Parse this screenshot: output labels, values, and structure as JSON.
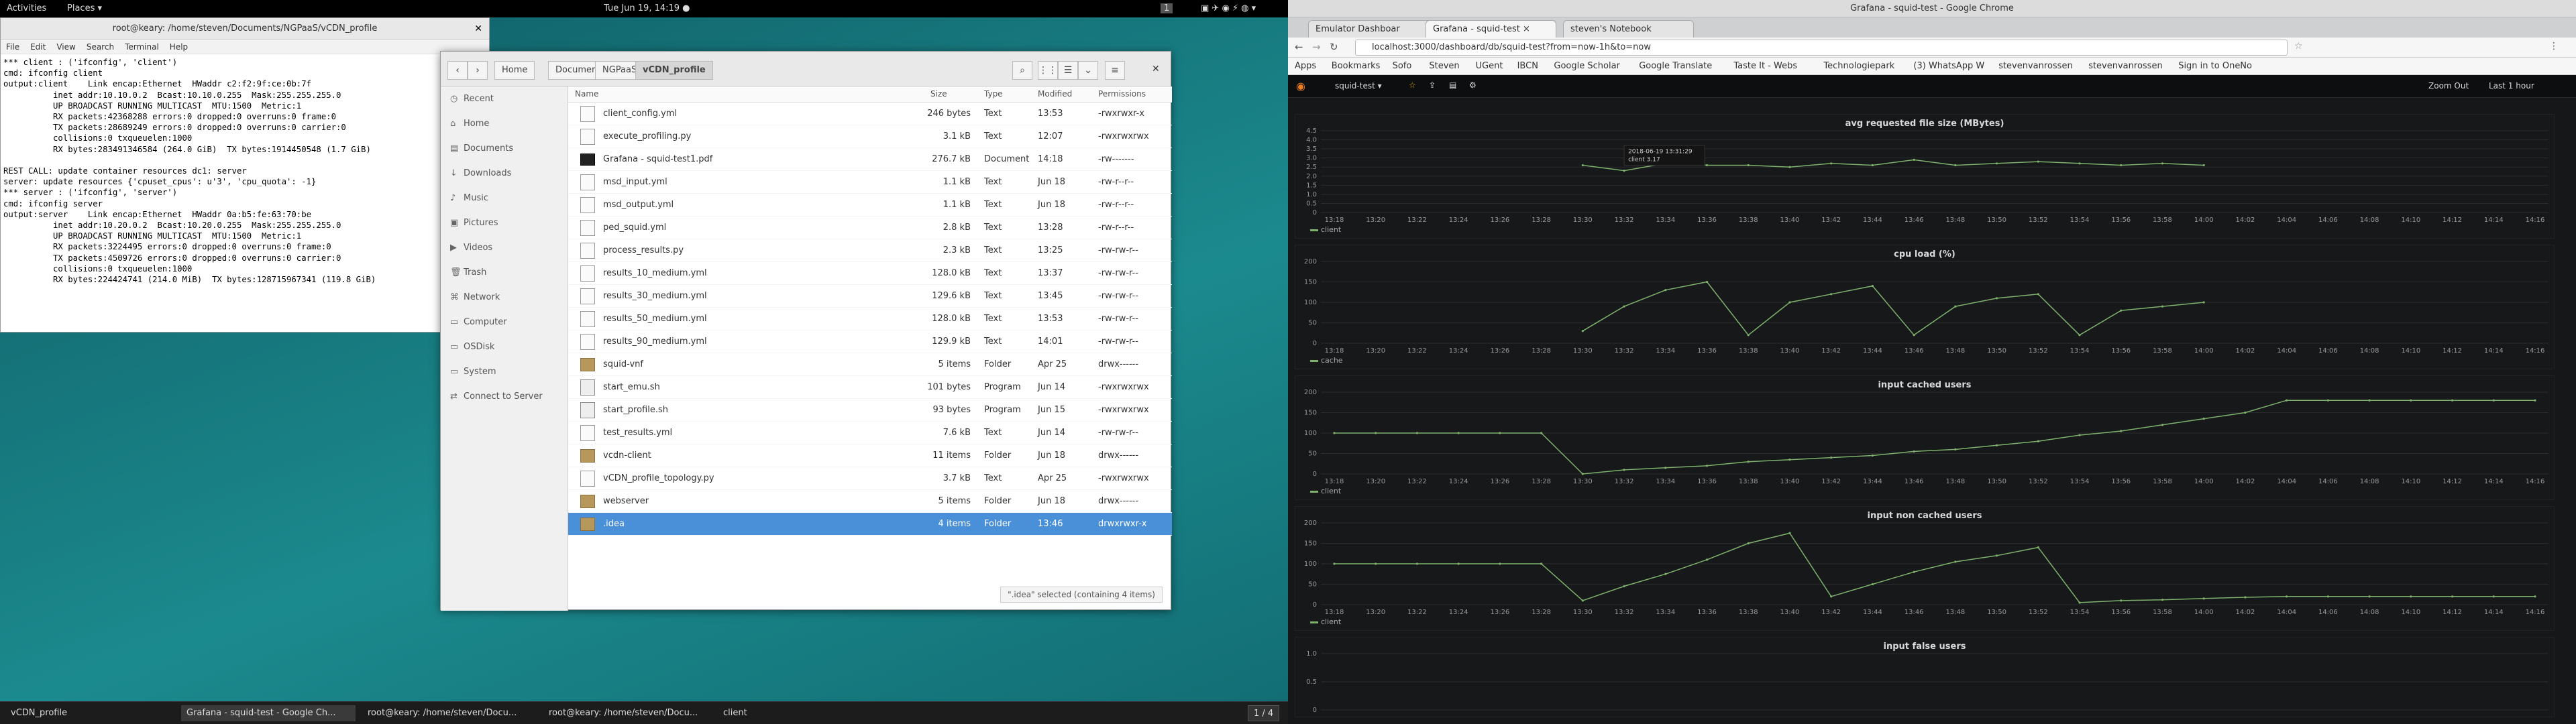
{
  "topbar": {
    "activities": "Activities",
    "places": "Places ▾",
    "clock": "Tue Jun 19, 14:19 ●",
    "workspace": "1"
  },
  "terminal": {
    "title": "root@keary: /home/steven/Documents/NGPaaS/vCDN_profile",
    "menu": [
      "File",
      "Edit",
      "View",
      "Search",
      "Terminal",
      "Help"
    ],
    "lines": [
      "*** client : ('ifconfig', 'client')",
      "cmd: ifconfig client",
      "output:client    Link encap:Ethernet  HWaddr c2:f2:9f:ce:0b:7f",
      "          inet addr:10.10.0.2  Bcast:10.10.0.255  Mask:255.255.255.0",
      "          UP BROADCAST RUNNING MULTICAST  MTU:1500  Metric:1",
      "          RX packets:42368288 errors:0 dropped:0 overruns:0 frame:0",
      "          TX packets:28689249 errors:0 dropped:0 overruns:0 carrier:0",
      "          collisions:0 txqueuelen:1000",
      "          RX bytes:283491346584 (264.0 GiB)  TX bytes:1914450548 (1.7 GiB)",
      "",
      "REST CALL: update container resources dc1: server",
      "server: update resources {'cpuset_cpus': u'3', 'cpu_quota': -1}",
      "*** server : ('ifconfig', 'server')",
      "cmd: ifconfig server",
      "output:server    Link encap:Ethernet  HWaddr 0a:b5:fe:63:70:be",
      "          inet addr:10.20.0.2  Bcast:10.20.0.255  Mask:255.255.255.0",
      "          UP BROADCAST RUNNING MULTICAST  MTU:1500  Metric:1",
      "          RX packets:3224495 errors:0 dropped:0 overruns:0 frame:0",
      "          TX packets:4509726 errors:0 dropped:0 overruns:0 carrier:0",
      "          collisions:0 txqueuelen:1000",
      "          RX bytes:224424741 (214.0 MiB)  TX bytes:128715967341 (119.8 GiB)",
      "",
      ""
    ]
  },
  "filemanager": {
    "crumbs": [
      "Home",
      "Documents",
      "NGPaaS",
      "vCDN_profile"
    ],
    "sidebar": [
      {
        "icon": "recent-icon",
        "glyph": "◷",
        "label": "Recent"
      },
      {
        "icon": "home-icon",
        "glyph": "⌂",
        "label": "Home"
      },
      {
        "icon": "documents-icon",
        "glyph": "▤",
        "label": "Documents"
      },
      {
        "icon": "downloads-icon",
        "glyph": "↓",
        "label": "Downloads"
      },
      {
        "icon": "music-icon",
        "glyph": "♪",
        "label": "Music"
      },
      {
        "icon": "pictures-icon",
        "glyph": "▣",
        "label": "Pictures"
      },
      {
        "icon": "videos-icon",
        "glyph": "▶",
        "label": "Videos"
      },
      {
        "icon": "trash-icon",
        "glyph": "🗑",
        "label": "Trash"
      },
      {
        "icon": "network-icon",
        "glyph": "⌘",
        "label": "Network"
      },
      {
        "icon": "computer-icon",
        "glyph": "▭",
        "label": "Computer"
      },
      {
        "icon": "disk-icon",
        "glyph": "▭",
        "label": "OSDisk"
      },
      {
        "icon": "disk-icon",
        "glyph": "▭",
        "label": "System"
      },
      {
        "icon": "server-icon",
        "glyph": "⇄",
        "label": "Connect to Server"
      }
    ],
    "columns": [
      "Name",
      "Size",
      "Type",
      "Modified",
      "Permissions"
    ],
    "files": [
      {
        "name": "client_config.yml",
        "size": "246 bytes",
        "type": "Text",
        "modified": "13:53",
        "perm": "-rwxrwxr-x",
        "kind": "text"
      },
      {
        "name": "execute_profiling.py",
        "size": "3.1 kB",
        "type": "Text",
        "modified": "12:07",
        "perm": "-rwxrwxrwx",
        "kind": "text"
      },
      {
        "name": "Grafana - squid-test1.pdf",
        "size": "276.7 kB",
        "type": "Document",
        "modified": "14:18",
        "perm": "-rw-------",
        "kind": "pdf"
      },
      {
        "name": "msd_input.yml",
        "size": "1.1 kB",
        "type": "Text",
        "modified": "Jun 18",
        "perm": "-rw-r--r--",
        "kind": "text"
      },
      {
        "name": "msd_output.yml",
        "size": "1.1 kB",
        "type": "Text",
        "modified": "Jun 18",
        "perm": "-rw-r--r--",
        "kind": "text"
      },
      {
        "name": "ped_squid.yml",
        "size": "2.8 kB",
        "type": "Text",
        "modified": "13:28",
        "perm": "-rw-r--r--",
        "kind": "text"
      },
      {
        "name": "process_results.py",
        "size": "2.3 kB",
        "type": "Text",
        "modified": "13:25",
        "perm": "-rw-rw-r--",
        "kind": "text"
      },
      {
        "name": "results_10_medium.yml",
        "size": "128.0 kB",
        "type": "Text",
        "modified": "13:37",
        "perm": "-rw-rw-r--",
        "kind": "text"
      },
      {
        "name": "results_30_medium.yml",
        "size": "129.6 kB",
        "type": "Text",
        "modified": "13:45",
        "perm": "-rw-rw-r--",
        "kind": "text"
      },
      {
        "name": "results_50_medium.yml",
        "size": "128.0 kB",
        "type": "Text",
        "modified": "13:53",
        "perm": "-rw-rw-r--",
        "kind": "text"
      },
      {
        "name": "results_90_medium.yml",
        "size": "129.9 kB",
        "type": "Text",
        "modified": "14:01",
        "perm": "-rw-rw-r--",
        "kind": "text"
      },
      {
        "name": "squid-vnf",
        "size": "5 items",
        "type": "Folder",
        "modified": "Apr 25",
        "perm": "drwx------",
        "kind": "folder"
      },
      {
        "name": "start_emu.sh",
        "size": "101 bytes",
        "type": "Program",
        "modified": "Jun 14",
        "perm": "-rwxrwxrwx",
        "kind": "prog"
      },
      {
        "name": "start_profile.sh",
        "size": "93 bytes",
        "type": "Program",
        "modified": "Jun 15",
        "perm": "-rwxrwxrwx",
        "kind": "prog"
      },
      {
        "name": "test_results.yml",
        "size": "7.6 kB",
        "type": "Text",
        "modified": "Jun 14",
        "perm": "-rw-rw-r--",
        "kind": "text"
      },
      {
        "name": "vcdn-client",
        "size": "11 items",
        "type": "Folder",
        "modified": "Jun 18",
        "perm": "drwx------",
        "kind": "folder"
      },
      {
        "name": "vCDN_profile_topology.py",
        "size": "3.7 kB",
        "type": "Text",
        "modified": "Apr 25",
        "perm": "-rwxrwxrwx",
        "kind": "text"
      },
      {
        "name": "webserver",
        "size": "5 items",
        "type": "Folder",
        "modified": "Jun 18",
        "perm": "drwx------",
        "kind": "folder"
      },
      {
        "name": ".idea",
        "size": "4 items",
        "type": "Folder",
        "modified": "13:46",
        "perm": "drwxrwxr-x",
        "kind": "folder",
        "selected": true
      }
    ],
    "status": "\".idea\" selected (containing 4 items)"
  },
  "chrome": {
    "window_title": "Grafana - squid-test - Google Chrome",
    "tabs": [
      "Emulator Dashboar",
      "Grafana - squid-test ×",
      "steven's Notebook"
    ],
    "url": "localhost:3000/dashboard/db/squid-test?from=now-1h&to=now",
    "bookmarks": [
      "Apps",
      "Bookmarks",
      "Sofo",
      "Steven",
      "UGent",
      "IBCN",
      "Google Scholar",
      "Google Translate",
      "Taste It - Webs",
      "Technologiepark",
      "(3) WhatsApp W",
      "stevenvanrossen",
      "stevenvanrossen",
      "Sign in to OneNo"
    ],
    "grafana": {
      "dashboard": "squid-test ▾",
      "zoom": "Zoom Out",
      "range": "Last 1 hour"
    }
  },
  "taskbar": {
    "items": [
      "vCDN_profile",
      "Grafana - squid-test - Google Ch...",
      "root@keary: /home/steven/Docu...",
      "root@keary: /home/steven/Docu...",
      "client"
    ],
    "pager": "1 / 4"
  },
  "chart_data": [
    {
      "type": "line",
      "title": "avg requested file size (MBytes)",
      "series": [
        {
          "name": "client"
        }
      ],
      "ylim": [
        0,
        4.5
      ],
      "yticks": [
        "0",
        "0.5",
        "1.0",
        "1.5",
        "2.0",
        "2.5",
        "3.0",
        "3.5",
        "4.0",
        "4.5"
      ],
      "tooltip": [
        "2018-06-19 13:31:29",
        "client   3.17"
      ],
      "x": [
        "13:18",
        "13:20",
        "13:22",
        "13:24",
        "13:26",
        "13:28",
        "13:30",
        "13:32",
        "13:34",
        "13:36",
        "13:38",
        "13:40",
        "13:42",
        "13:44",
        "13:46",
        "13:48",
        "13:50",
        "13:52",
        "13:54",
        "13:56",
        "13:58",
        "14:00",
        "14:02",
        "14:04",
        "14:06",
        "14:08",
        "14:10",
        "14:12",
        "14:14",
        "14:16"
      ],
      "y": [
        null,
        null,
        null,
        null,
        null,
        null,
        2.6,
        2.3,
        2.7,
        2.6,
        2.6,
        2.5,
        2.7,
        2.6,
        2.9,
        2.6,
        2.7,
        2.8,
        2.7,
        2.6,
        2.7,
        2.6,
        null,
        null,
        null,
        null,
        null,
        null,
        null,
        null
      ]
    },
    {
      "type": "line",
      "title": "cpu load (%)",
      "series": [
        {
          "name": "cache"
        }
      ],
      "ylim": [
        0,
        200
      ],
      "yticks": [
        "0",
        "50",
        "100",
        "150",
        "200"
      ],
      "x": [
        "13:18",
        "13:20",
        "13:22",
        "13:24",
        "13:26",
        "13:28",
        "13:30",
        "13:32",
        "13:34",
        "13:36",
        "13:38",
        "13:40",
        "13:42",
        "13:44",
        "13:46",
        "13:48",
        "13:50",
        "13:52",
        "13:54",
        "13:56",
        "13:58",
        "14:00",
        "14:02",
        "14:04",
        "14:06",
        "14:08",
        "14:10",
        "14:12",
        "14:14",
        "14:16"
      ],
      "y": [
        null,
        null,
        null,
        null,
        null,
        null,
        30,
        90,
        130,
        150,
        20,
        100,
        120,
        140,
        20,
        90,
        110,
        120,
        20,
        80,
        90,
        100,
        null,
        null,
        null,
        null,
        null,
        null,
        null,
        null
      ]
    },
    {
      "type": "line",
      "title": "input cached users",
      "series": [
        {
          "name": "client"
        }
      ],
      "ylim": [
        0,
        200
      ],
      "yticks": [
        "0",
        "50",
        "100",
        "150",
        "200"
      ],
      "x": [
        "13:18",
        "13:20",
        "13:22",
        "13:24",
        "13:26",
        "13:28",
        "13:30",
        "13:32",
        "13:34",
        "13:36",
        "13:38",
        "13:40",
        "13:42",
        "13:44",
        "13:46",
        "13:48",
        "13:50",
        "13:52",
        "13:54",
        "13:56",
        "13:58",
        "14:00",
        "14:02",
        "14:04",
        "14:06",
        "14:08",
        "14:10",
        "14:12",
        "14:14",
        "14:16"
      ],
      "y": [
        100,
        100,
        100,
        100,
        100,
        100,
        0,
        10,
        15,
        20,
        30,
        35,
        40,
        45,
        55,
        60,
        70,
        80,
        95,
        105,
        120,
        135,
        150,
        180,
        180,
        180,
        180,
        180,
        180,
        180
      ]
    },
    {
      "type": "line",
      "title": "input non cached users",
      "series": [
        {
          "name": "client"
        }
      ],
      "ylim": [
        0,
        200
      ],
      "yticks": [
        "0",
        "50",
        "100",
        "150",
        "200"
      ],
      "x": [
        "13:18",
        "13:20",
        "13:22",
        "13:24",
        "13:26",
        "13:28",
        "13:30",
        "13:32",
        "13:34",
        "13:36",
        "13:38",
        "13:40",
        "13:42",
        "13:44",
        "13:46",
        "13:48",
        "13:50",
        "13:52",
        "13:54",
        "13:56",
        "13:58",
        "14:00",
        "14:02",
        "14:04",
        "14:06",
        "14:08",
        "14:10",
        "14:12",
        "14:14",
        "14:16"
      ],
      "y": [
        100,
        100,
        100,
        100,
        100,
        100,
        10,
        45,
        75,
        110,
        150,
        175,
        20,
        50,
        80,
        105,
        120,
        140,
        5,
        10,
        12,
        15,
        18,
        20,
        20,
        20,
        20,
        20,
        20,
        20
      ]
    },
    {
      "type": "line",
      "title": "input false users",
      "series": [],
      "ylim": [
        0,
        1.0
      ],
      "yticks": [
        "0",
        "0.5",
        "1.0"
      ],
      "x": [],
      "y": []
    }
  ]
}
